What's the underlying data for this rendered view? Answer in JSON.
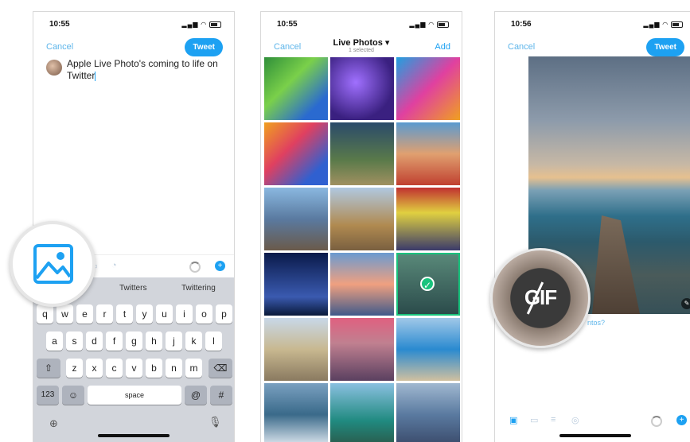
{
  "screen1": {
    "status_time": "10:55",
    "cancel_label": "Cancel",
    "tweet_label": "Tweet",
    "compose_text": "Apple Live Photo's coming to life on Twitter",
    "suggestions": [
      "Twitters",
      "Twittering"
    ],
    "keyboard": {
      "row1": [
        "q",
        "w",
        "e",
        "r",
        "t",
        "y",
        "u",
        "i",
        "o",
        "p"
      ],
      "row2": [
        "a",
        "s",
        "d",
        "f",
        "g",
        "h",
        "j",
        "k",
        "l"
      ],
      "row3": [
        "z",
        "x",
        "c",
        "v",
        "b",
        "n",
        "m"
      ],
      "numbers_key": "123",
      "space_key": "space",
      "at_key": "@",
      "hash_key": "#"
    }
  },
  "screen2": {
    "status_time": "10:55",
    "cancel_label": "Cancel",
    "title": "Live Photos",
    "subtitle": "1 selected",
    "add_label": "Add",
    "grid_colors": [
      [
        "#4fb35a",
        "#5a3fae",
        "#c43f8a"
      ],
      [
        "#e0583a",
        "#3a5f7a",
        "#c0402a"
      ],
      [
        "#5a8fc8",
        "#b58a4a",
        "#c84040"
      ],
      [
        "#1a2a6a",
        "#e89a6a",
        "#3a6a5a"
      ],
      [
        "#c8b8a0",
        "#c85a6a",
        "#2a7ab8"
      ],
      [
        "#5a8aa8",
        "#2a8a8a",
        "#5a7aa8"
      ]
    ],
    "selected_index": 11
  },
  "screen3": {
    "status_time": "10:56",
    "cancel_label": "Cancel",
    "tweet_label": "Tweet",
    "gif_label": "GIF",
    "hint_fragment": "ntos?"
  },
  "colors": {
    "accent": "#1da1f2",
    "keyboard_bg": "#d2d5db"
  }
}
